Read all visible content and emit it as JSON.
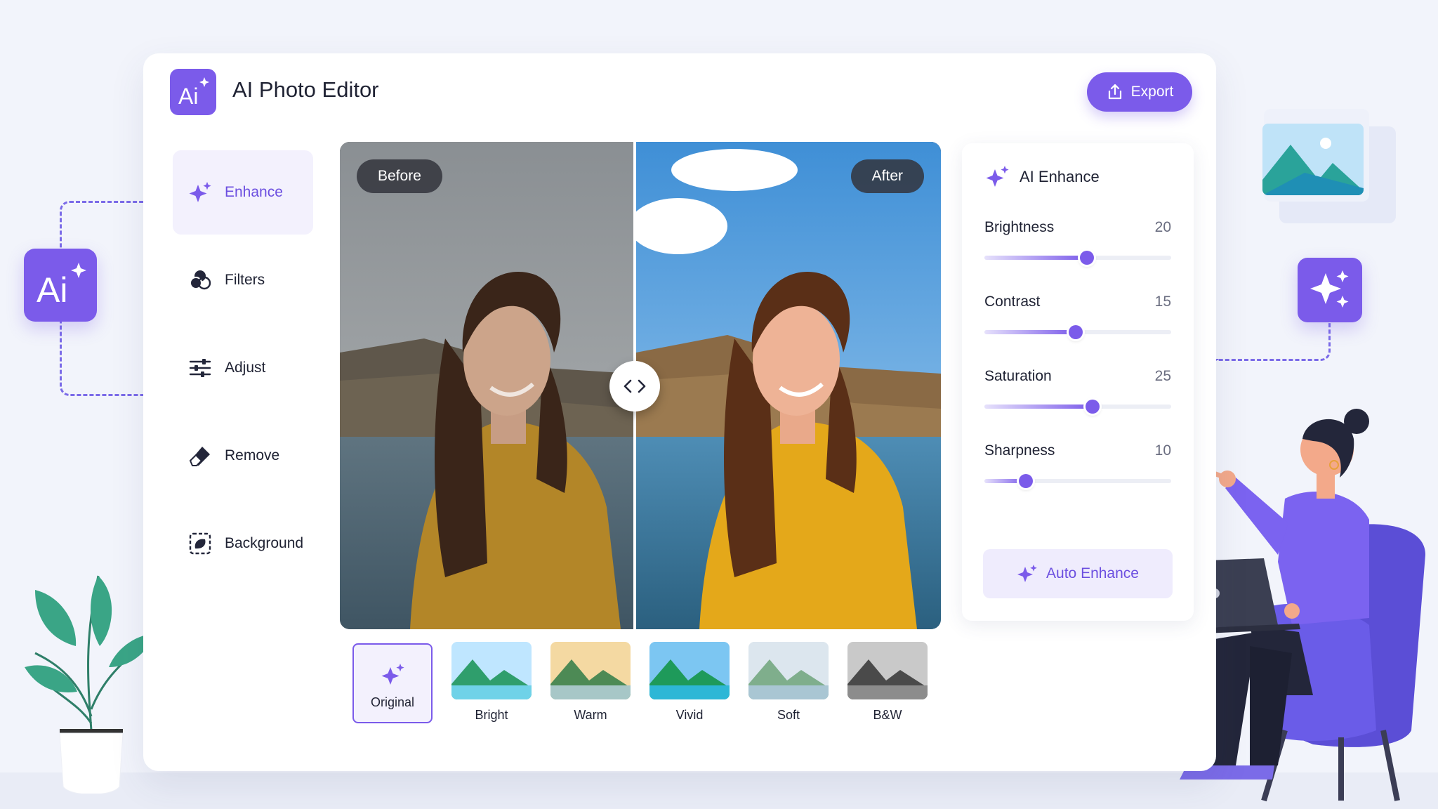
{
  "app": {
    "title": "AI Photo Editor",
    "logo_icon": "ai-sparkle-icon",
    "export_label": "Export"
  },
  "sidebar": {
    "items": [
      {
        "label": "Enhance",
        "icon": "sparkle-icon",
        "active": true
      },
      {
        "label": "Filters",
        "icon": "filters-icon"
      },
      {
        "label": "Adjust",
        "icon": "sliders-icon"
      },
      {
        "label": "Remove",
        "icon": "eraser-icon"
      },
      {
        "label": "Background",
        "icon": "background-select-icon"
      }
    ]
  },
  "compare": {
    "before_label": "Before",
    "after_label": "After",
    "split_fraction": 0.49
  },
  "filters": [
    {
      "label": "Original",
      "selected": true
    },
    {
      "label": "Bright"
    },
    {
      "label": "Warm"
    },
    {
      "label": "Vivid"
    },
    {
      "label": "Soft"
    },
    {
      "label": "B&W"
    }
  ],
  "panel": {
    "title": "AI Enhance",
    "sliders": [
      {
        "label": "Brightness",
        "value": "20",
        "level": 0.55
      },
      {
        "label": "Contrast",
        "value": "15",
        "level": 0.49
      },
      {
        "label": "Saturation",
        "value": "25",
        "level": 0.58
      },
      {
        "label": "Sharpness",
        "value": "10",
        "level": 0.22
      }
    ],
    "auto_label": "Auto Enhance"
  },
  "colors": {
    "accent": "#7b5bea",
    "accent_soft": "#f3f1fd",
    "background": "#f2f4fb"
  }
}
